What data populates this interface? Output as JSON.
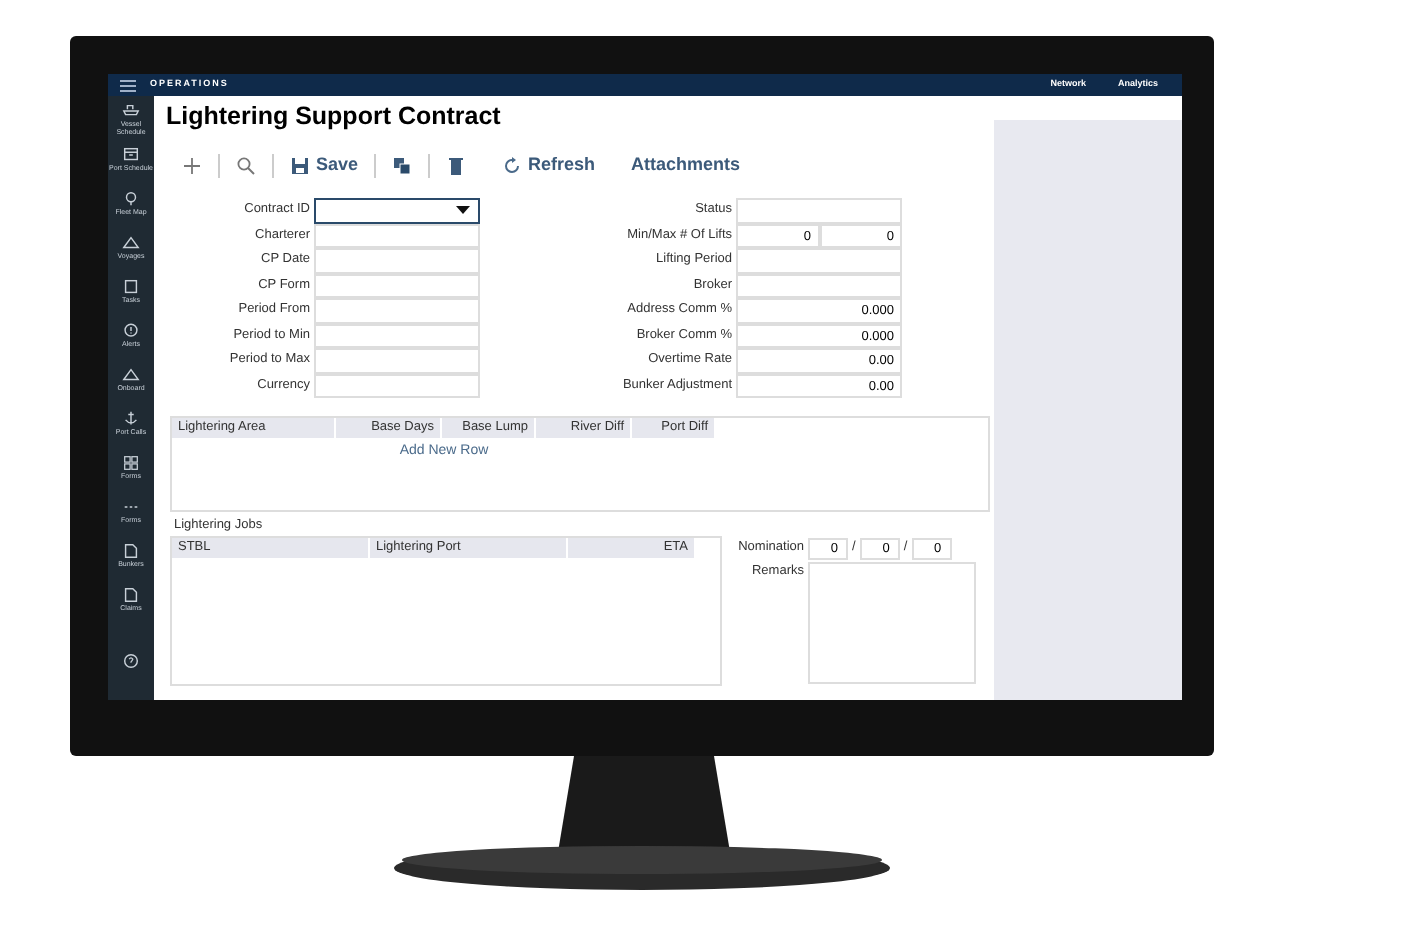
{
  "app_bar": {
    "title": "OPERATIONS",
    "links": [
      "Network",
      "Analytics"
    ]
  },
  "sidebar": {
    "items": [
      {
        "label": "Vessel Schedule"
      },
      {
        "label": "Port Schedule"
      },
      {
        "label": "Fleet Map"
      },
      {
        "label": "Voyages"
      },
      {
        "label": "Tasks"
      },
      {
        "label": "Alerts"
      },
      {
        "label": "Onboard"
      },
      {
        "label": "Port Calls"
      },
      {
        "label": "Forms"
      },
      {
        "label": "Forms"
      },
      {
        "label": "Bunkers"
      },
      {
        "label": "Claims"
      }
    ]
  },
  "title": "Lightering Support Contract",
  "toolbar": [
    {
      "kind": "add"
    },
    {
      "kind": "search"
    },
    {
      "kind": "save",
      "label": "Save"
    },
    {
      "kind": "copy"
    },
    {
      "kind": "delete"
    },
    {
      "kind": "refresh",
      "label": "Refresh"
    },
    {
      "kind": "text",
      "label": "Attachments"
    }
  ],
  "left_fields": [
    {
      "label": "Contract ID",
      "kind": "dropdown"
    },
    {
      "label": "Charterer",
      "kind": "text"
    },
    {
      "label": "CP Date",
      "kind": "text"
    },
    {
      "label": "CP Form",
      "kind": "text"
    },
    {
      "label": "Period From",
      "kind": "text"
    },
    {
      "label": "Period to Min",
      "kind": "text"
    },
    {
      "label": "Period to Max",
      "kind": "text"
    },
    {
      "label": "Currency",
      "kind": "text"
    }
  ],
  "right_fields": [
    {
      "label": "Status"
    },
    {
      "label": "Min/Max # Of Lifts",
      "values": [
        "0",
        "0"
      ]
    },
    {
      "label": "Lifting Period"
    },
    {
      "label": "Broker"
    },
    {
      "label": "Address Comm %",
      "values": [
        "0.000"
      ]
    },
    {
      "label": "Broker Comm %",
      "values": [
        "0.000"
      ]
    },
    {
      "label": "Overtime Rate",
      "values": [
        "0.00"
      ]
    },
    {
      "label": "Bunker Adjustment",
      "values": [
        "0.00"
      ]
    }
  ],
  "areas_table": {
    "columns": [
      "Lightering Area",
      "Base Days",
      "Base Lump",
      "River Diff",
      "Port Diff"
    ],
    "add_row": "Add New Row"
  },
  "jobs": {
    "title": "Lightering Jobs",
    "columns": [
      "STBL",
      "Lightering Port",
      "ETA"
    ]
  },
  "nomination": {
    "label": "Nomination",
    "values": [
      "0",
      "0",
      "0"
    ],
    "separator": "/"
  },
  "remarks": {
    "label": "Remarks"
  }
}
